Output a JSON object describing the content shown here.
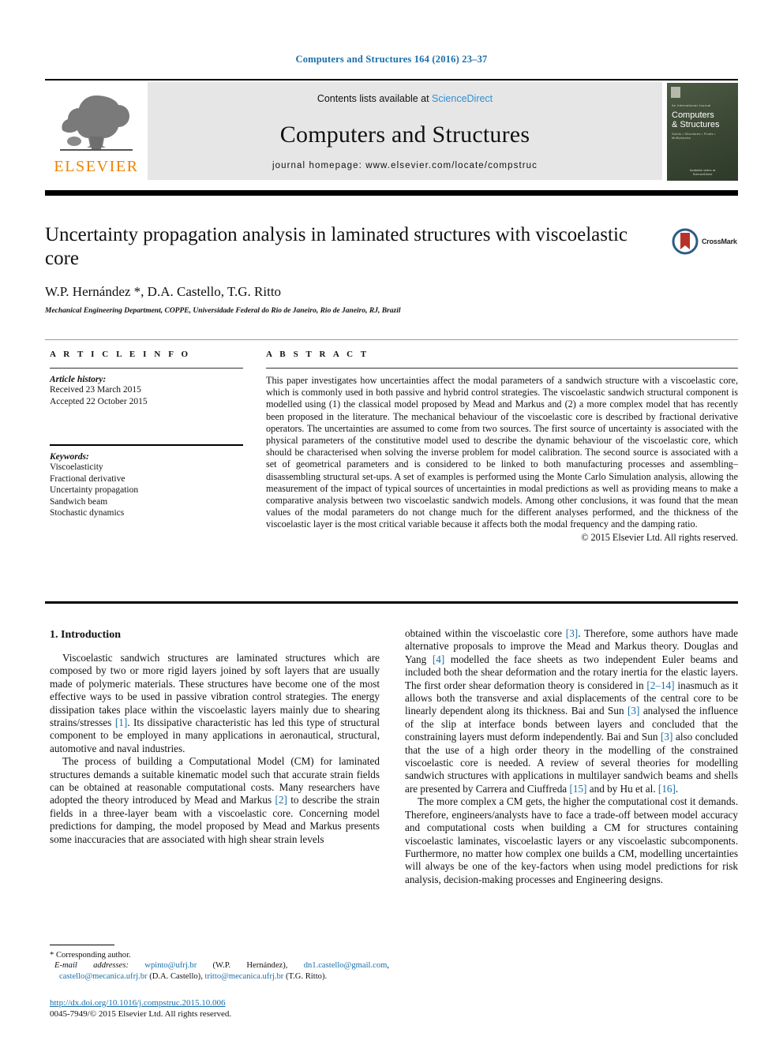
{
  "running_head": "Computers and Structures 164 (2016) 23–37",
  "masthead": {
    "publisher_logo_text": "ELSEVIER",
    "contents_prefix": "Contents lists available at ",
    "contents_link": "ScienceDirect",
    "journal_title": "Computers and Structures",
    "homepage": "journal homepage: www.elsevier.com/locate/compstruc",
    "cover": {
      "kicker": "An International Journal",
      "title_line1": "Computers",
      "title_line2": "& Structures",
      "subtitle": "Solids • Structures • Fluids • Multiphysics",
      "footer_line1": "Available online at",
      "footer_line2": "ScienceDirect"
    }
  },
  "article": {
    "title": "Uncertainty propagation analysis in laminated structures with viscoelastic core",
    "authors": "W.P. Hernández *, D.A. Castello, T.G. Ritto",
    "corresponding_marker": "*",
    "affiliation": "Mechanical Engineering Department, COPPE, Universidade Federal do Rio de Janeiro, Rio de Janeiro, RJ, Brazil",
    "crossmark_label": "CrossMark"
  },
  "article_info": {
    "heading": "A R T I C L E  I N F O",
    "history_label": "Article history:",
    "history": [
      "Received 23 March 2015",
      "Accepted 22 October 2015"
    ],
    "keywords_label": "Keywords:",
    "keywords": [
      "Viscoelasticity",
      "Fractional derivative",
      "Uncertainty propagation",
      "Sandwich beam",
      "Stochastic dynamics"
    ]
  },
  "abstract": {
    "heading": "A B S T R A C T",
    "text": "This paper investigates how uncertainties affect the modal parameters of a sandwich structure with a viscoelastic core, which is commonly used in both passive and hybrid control strategies. The viscoelastic sandwich structural component is modelled using (1) the classical model proposed by Mead and Markus and (2) a more complex model that has recently been proposed in the literature. The mechanical behaviour of the viscoelastic core is described by fractional derivative operators. The uncertainties are assumed to come from two sources. The first source of uncertainty is associated with the physical parameters of the constitutive model used to describe the dynamic behaviour of the viscoelastic core, which should be characterised when solving the inverse problem for model calibration. The second source is associated with a set of geometrical parameters and is considered to be linked to both manufacturing processes and assembling–disassembling structural set-ups. A set of examples is performed using the Monte Carlo Simulation analysis, allowing the measurement of the impact of typical sources of uncertainties in modal predictions as well as providing means to make a comparative analysis between two viscoelastic sandwich models. Among other conclusions, it was found that the mean values of the modal parameters do not change much for the different analyses performed, and the thickness of the viscoelastic layer is the most critical variable because it affects both the modal frequency and the damping ratio.",
    "copyright": "© 2015 Elsevier Ltd. All rights reserved."
  },
  "body": {
    "section_title": "1. Introduction",
    "left_paragraphs": [
      "Viscoelastic sandwich structures are laminated structures which are composed by two or more rigid layers joined by soft layers that are usually made of polymeric materials. These structures have become one of the most effective ways to be used in passive vibration control strategies. The energy dissipation takes place within the viscoelastic layers mainly due to shearing strains/stresses [1]. Its dissipative characteristic has led this type of structural component to be employed in many applications in aeronautical, structural, automotive and naval industries.",
      "The process of building a Computational Model (CM) for laminated structures demands a suitable kinematic model such that accurate strain fields can be obtained at reasonable computational costs. Many researchers have adopted the theory introduced by Mead and Markus [2] to describe the strain fields in a three-layer beam with a viscoelastic core. Concerning model predictions for damping, the model proposed by Mead and Markus presents some inaccuracies that are associated with high shear strain levels"
    ],
    "right_paragraphs": [
      "obtained within the viscoelastic core [3]. Therefore, some authors have made alternative proposals to improve the Mead and Markus theory. Douglas and Yang [4] modelled the face sheets as two independent Euler beams and included both the shear deformation and the rotary inertia for the elastic layers. The first order shear deformation theory is considered in [2–14] inasmuch as it allows both the transverse and axial displacements of the central core to be linearly dependent along its thickness. Bai and Sun [3] analysed the influence of the slip at interface bonds between layers and concluded that the constraining layers must deform independently. Bai and Sun [3] also concluded that the use of a high order theory in the modelling of the constrained viscoelastic core is needed. A review of several theories for modelling sandwich structures with applications in multilayer sandwich beams and shells are presented by Carrera and Ciuffreda [15] and by Hu et al. [16].",
      "The more complex a CM gets, the higher the computational cost it demands. Therefore, engineers/analysts have to face a trade-off between model accuracy and computational costs when building a CM for structures containing viscoelastic laminates, viscoelastic layers or any viscoelastic subcomponents. Furthermore, no matter how complex one builds a CM, modelling uncertainties will always be one of the key-factors when using model predictions for risk analysis, decision-making processes and Engineering designs."
    ]
  },
  "footnote": {
    "corresponding": "* Corresponding author.",
    "email_label": "E-mail addresses:",
    "emails": [
      {
        "address": "wpinto@ufrj.br",
        "owner": "(W.P. Hernández)"
      },
      {
        "address": "dn1.castello@gmail.com",
        "owner": ""
      },
      {
        "address": "castello@mecanica.ufrj.br",
        "owner": "(D.A. Castello)"
      },
      {
        "address": "tritto@mecanica.ufrj.br",
        "owner": "(T.G. Ritto)"
      }
    ]
  },
  "doi": {
    "url": "http://dx.doi.org/10.1016/j.compstruc.2015.10.006",
    "issn_line": "0045-7949/© 2015 Elsevier Ltd. All rights reserved."
  },
  "colors": {
    "link_blue": "#1a6ea8",
    "sciencedirect_blue": "#2f8fd0",
    "elsevier_orange": "#ef8200",
    "masthead_grey": "#e6e6e6"
  }
}
